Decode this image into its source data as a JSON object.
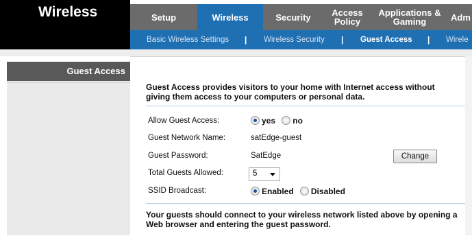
{
  "app": {
    "title": "Wireless"
  },
  "main_nav": [
    {
      "label": "Setup"
    },
    {
      "label": "Wireless"
    },
    {
      "label": "Security"
    },
    {
      "label": "Access Policy"
    },
    {
      "label": "Applications & Gaming"
    },
    {
      "label": "Adm"
    }
  ],
  "sub_nav": [
    {
      "label": "Basic Wireless Settings"
    },
    {
      "label": "Wireless Security"
    },
    {
      "label": "Guest Access"
    },
    {
      "label": "Wirele"
    }
  ],
  "sub_nav_separator": "|",
  "section": {
    "title": "Guest Access"
  },
  "intro_text": "Guest Access provides visitors to your home with Internet access without giving them access to your computers or personal data.",
  "fields": {
    "allow_guest_access": {
      "label": "Allow Guest Access:",
      "options": [
        "yes",
        "no"
      ],
      "selected": "yes"
    },
    "network_name": {
      "label": "Guest Network Name:",
      "value": "satEdge-guest"
    },
    "password": {
      "label": "Guest Password:",
      "value": "SatEdge",
      "button": "Change"
    },
    "total_guests": {
      "label": "Total Guests Allowed:",
      "value": "5"
    },
    "ssid_broadcast": {
      "label": "SSID Broadcast:",
      "options": [
        "Enabled",
        "Disabled"
      ],
      "selected": "Enabled"
    }
  },
  "outro_text": "Your guests should connect to your wireless network listed above by opening a Web browser and entering the guest password.",
  "colors": {
    "active_tab": "#1f6fb3",
    "nav_gray": "#6b6b6b",
    "sidebar_header": "#595959"
  }
}
